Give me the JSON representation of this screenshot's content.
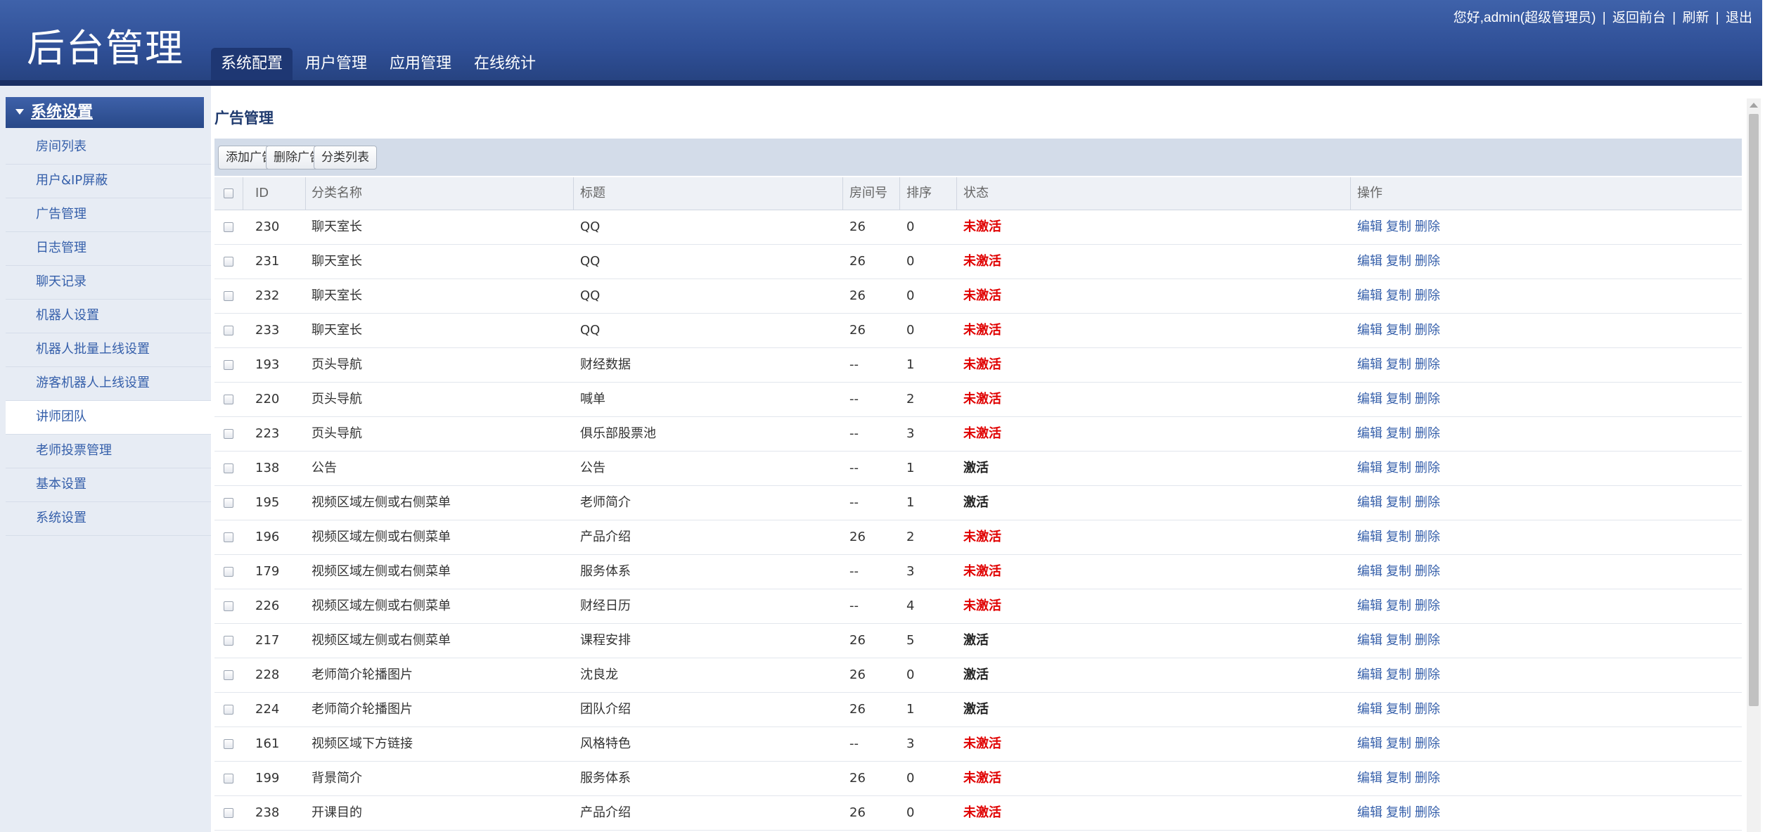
{
  "header": {
    "logo": "后台管理",
    "greeting": "您好,admin(超级管理员)",
    "links": [
      "返回前台",
      "刷新",
      "退出"
    ],
    "tabs": [
      {
        "label": "系统配置",
        "active": true
      },
      {
        "label": "用户管理",
        "active": false
      },
      {
        "label": "应用管理",
        "active": false
      },
      {
        "label": "在线统计",
        "active": false
      }
    ]
  },
  "sidebar": {
    "title": "系统设置",
    "items": [
      {
        "label": "房间列表",
        "active": false
      },
      {
        "label": "用户&IP屏蔽",
        "active": false
      },
      {
        "label": "广告管理",
        "active": false
      },
      {
        "label": "日志管理",
        "active": false
      },
      {
        "label": "聊天记录",
        "active": false
      },
      {
        "label": "机器人设置",
        "active": false
      },
      {
        "label": "机器人批量上线设置",
        "active": false
      },
      {
        "label": "游客机器人上线设置",
        "active": false
      },
      {
        "label": "讲师团队",
        "active": true
      },
      {
        "label": "老师投票管理",
        "active": false
      },
      {
        "label": "基本设置",
        "active": false
      },
      {
        "label": "系统设置",
        "active": false
      }
    ]
  },
  "main": {
    "title": "广告管理",
    "toolbar": [
      "添加广告",
      "删除广告",
      "分类列表"
    ],
    "columns": {
      "id": "ID",
      "category": "分类名称",
      "title": "标题",
      "room": "房间号",
      "order": "排序",
      "status": "状态",
      "actions": "操作"
    },
    "action_labels": [
      "编辑",
      "复制",
      "删除"
    ],
    "rows": [
      {
        "id": "230",
        "category": "聊天室长",
        "title": "QQ",
        "room": "26",
        "order": "0",
        "status": "未激活",
        "active": false
      },
      {
        "id": "231",
        "category": "聊天室长",
        "title": "QQ",
        "room": "26",
        "order": "0",
        "status": "未激活",
        "active": false
      },
      {
        "id": "232",
        "category": "聊天室长",
        "title": "QQ",
        "room": "26",
        "order": "0",
        "status": "未激活",
        "active": false
      },
      {
        "id": "233",
        "category": "聊天室长",
        "title": "QQ",
        "room": "26",
        "order": "0",
        "status": "未激活",
        "active": false
      },
      {
        "id": "193",
        "category": "页头导航",
        "title": "财经数据",
        "room": "--",
        "order": "1",
        "status": "未激活",
        "active": false
      },
      {
        "id": "220",
        "category": "页头导航",
        "title": "喊单",
        "room": "--",
        "order": "2",
        "status": "未激活",
        "active": false
      },
      {
        "id": "223",
        "category": "页头导航",
        "title": "俱乐部股票池",
        "room": "--",
        "order": "3",
        "status": "未激活",
        "active": false
      },
      {
        "id": "138",
        "category": "公告",
        "title": "公告",
        "room": "--",
        "order": "1",
        "status": "激活",
        "active": true
      },
      {
        "id": "195",
        "category": "视频区域左侧或右侧菜单",
        "title": "老师简介",
        "room": "--",
        "order": "1",
        "status": "激活",
        "active": true
      },
      {
        "id": "196",
        "category": "视频区域左侧或右侧菜单",
        "title": "产品介绍",
        "room": "26",
        "order": "2",
        "status": "未激活",
        "active": false
      },
      {
        "id": "179",
        "category": "视频区域左侧或右侧菜单",
        "title": "服务体系",
        "room": "--",
        "order": "3",
        "status": "未激活",
        "active": false
      },
      {
        "id": "226",
        "category": "视频区域左侧或右侧菜单",
        "title": "财经日历",
        "room": "--",
        "order": "4",
        "status": "未激活",
        "active": false
      },
      {
        "id": "217",
        "category": "视频区域左侧或右侧菜单",
        "title": "课程安排",
        "room": "26",
        "order": "5",
        "status": "激活",
        "active": true
      },
      {
        "id": "228",
        "category": "老师简介轮播图片",
        "title": "沈良龙",
        "room": "26",
        "order": "0",
        "status": "激活",
        "active": true
      },
      {
        "id": "224",
        "category": "老师简介轮播图片",
        "title": "团队介绍",
        "room": "26",
        "order": "1",
        "status": "激活",
        "active": true
      },
      {
        "id": "161",
        "category": "视频区域下方链接",
        "title": "风格特色",
        "room": "--",
        "order": "3",
        "status": "未激活",
        "active": false
      },
      {
        "id": "199",
        "category": "背景简介",
        "title": "服务体系",
        "room": "26",
        "order": "0",
        "status": "未激活",
        "active": false
      },
      {
        "id": "238",
        "category": "开课目的",
        "title": "产品介绍",
        "room": "26",
        "order": "0",
        "status": "未激活",
        "active": false
      }
    ]
  },
  "colors": {
    "header_bg": "#2f4f96",
    "tab_active": "#1e3773",
    "sidebar_bg": "#e7ecf4",
    "link": "#355faa",
    "inactive_status": "#e00000",
    "toolbar_bg": "#d3dce9"
  }
}
